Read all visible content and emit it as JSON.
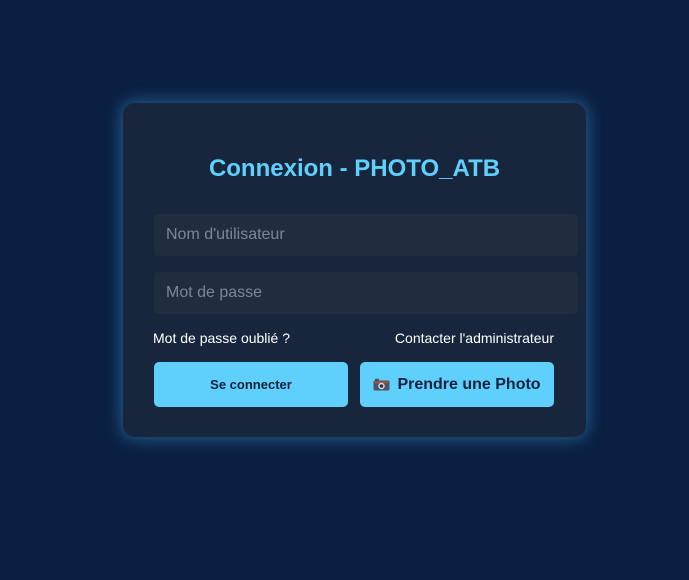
{
  "login": {
    "title": "Connexion - PHOTO_ATB",
    "username_placeholder": "Nom d'utilisateur",
    "password_placeholder": "Mot de passe",
    "forgot_password": "Mot de passe oublié ?",
    "contact_admin": "Contacter l'administrateur",
    "submit_label": "Se connecter",
    "photo_label": "Prendre une Photo",
    "photo_icon": "camera-icon"
  },
  "colors": {
    "background": "#0b1f42",
    "card": "#17263d",
    "accent": "#5fcffb",
    "input": "#1f2d3f"
  }
}
